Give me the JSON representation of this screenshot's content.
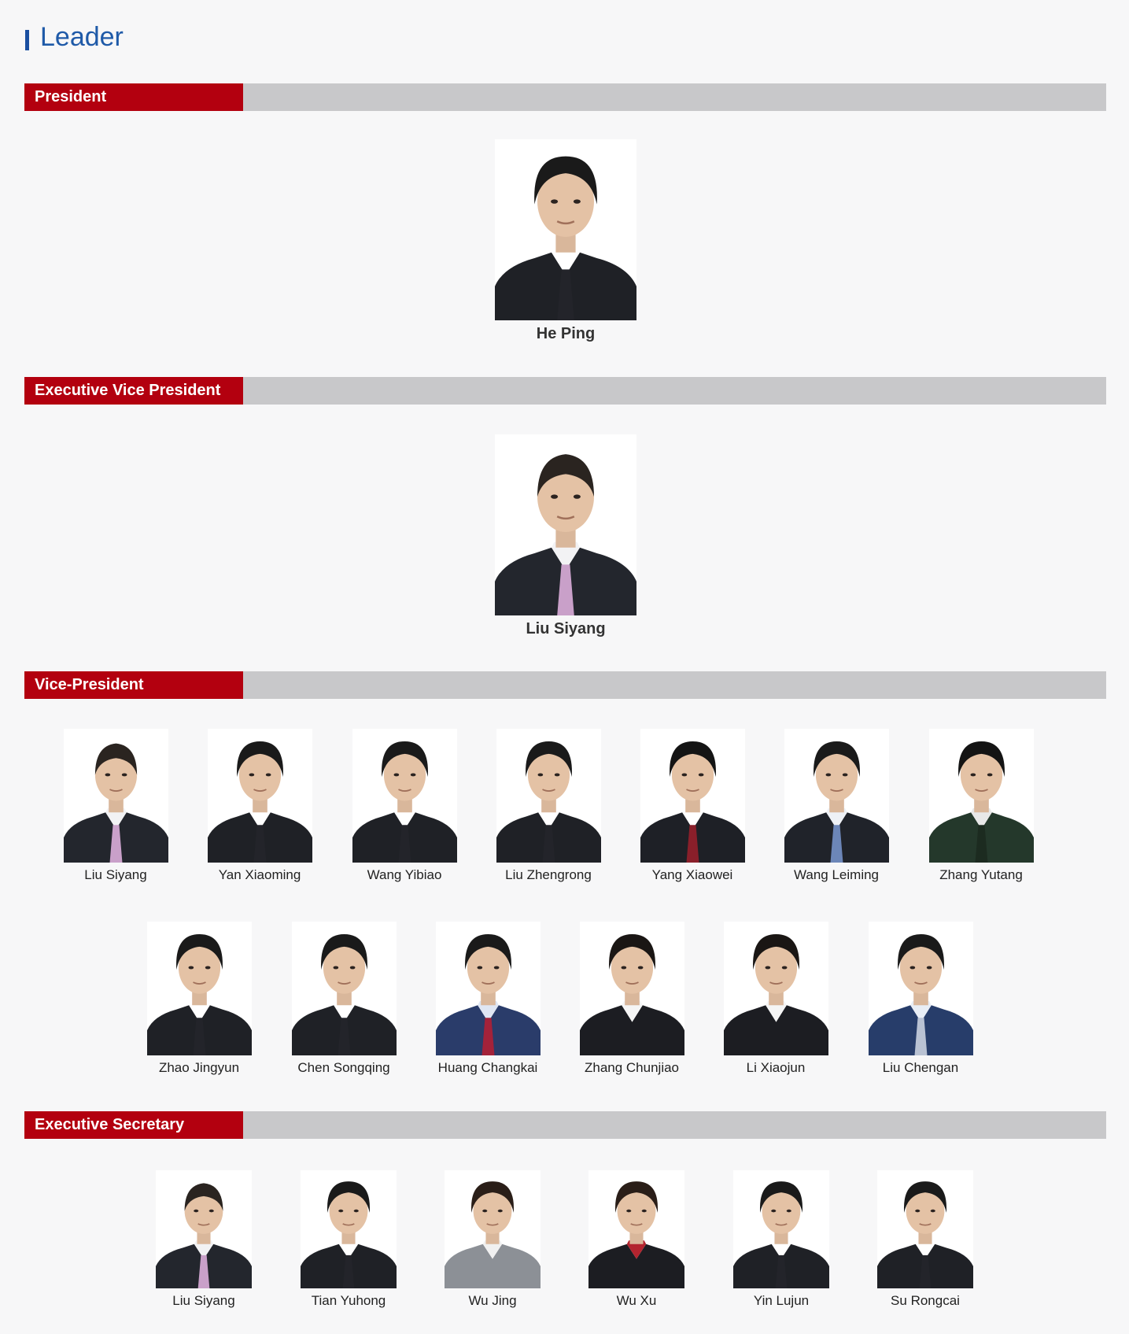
{
  "page": {
    "title": "Leader"
  },
  "sections": [
    {
      "label": "President",
      "people": [
        {
          "name": "He Ping",
          "attire": "dark-suit"
        }
      ]
    },
    {
      "label": "Executive Vice President",
      "people": [
        {
          "name": "Liu Siyang",
          "attire": "dark-suit-pink-tie"
        }
      ]
    },
    {
      "label": "Vice-President",
      "people": [
        {
          "name": "Liu Siyang",
          "attire": "dark-suit-pink-tie"
        },
        {
          "name": "Yan Xiaoming",
          "attire": "dark-suit"
        },
        {
          "name": "Wang Yibiao",
          "attire": "dark-suit"
        },
        {
          "name": "Liu Zhengrong",
          "attire": "dark-suit"
        },
        {
          "name": "Yang Xiaowei",
          "attire": "dark-suit-red-tie"
        },
        {
          "name": "Wang Leiming",
          "attire": "dark-suit-blue-tie"
        },
        {
          "name": "Zhang Yutang",
          "attire": "military-uniform"
        },
        {
          "name": "Zhao Jingyun",
          "attire": "dark-suit"
        },
        {
          "name": "Chen Songqing",
          "attire": "dark-suit"
        },
        {
          "name": "Huang Changkai",
          "attire": "blue-suit-red-tie"
        },
        {
          "name": "Zhang Chunjiao",
          "attire": "dark-jacket"
        },
        {
          "name": "Li Xiaojun",
          "attire": "dark-jacket"
        },
        {
          "name": "Liu Chengan",
          "attire": "blue-suit"
        }
      ]
    },
    {
      "label": "Executive Secretary",
      "people": [
        {
          "name": "Liu Siyang",
          "attire": "dark-suit-pink-tie"
        },
        {
          "name": "Tian Yuhong",
          "attire": "dark-suit"
        },
        {
          "name": "Wu Jing",
          "attire": "grey-jacket"
        },
        {
          "name": "Wu Xu",
          "attire": "dark-jacket-red-scarf"
        },
        {
          "name": "Yin Lujun",
          "attire": "dark-suit"
        },
        {
          "name": "Su Rongcai",
          "attire": "dark-suit"
        }
      ]
    }
  ],
  "colors": {
    "accent_red": "#b3000f",
    "header_grey": "#c8c8ca",
    "title_blue": "#1f5aa8"
  }
}
